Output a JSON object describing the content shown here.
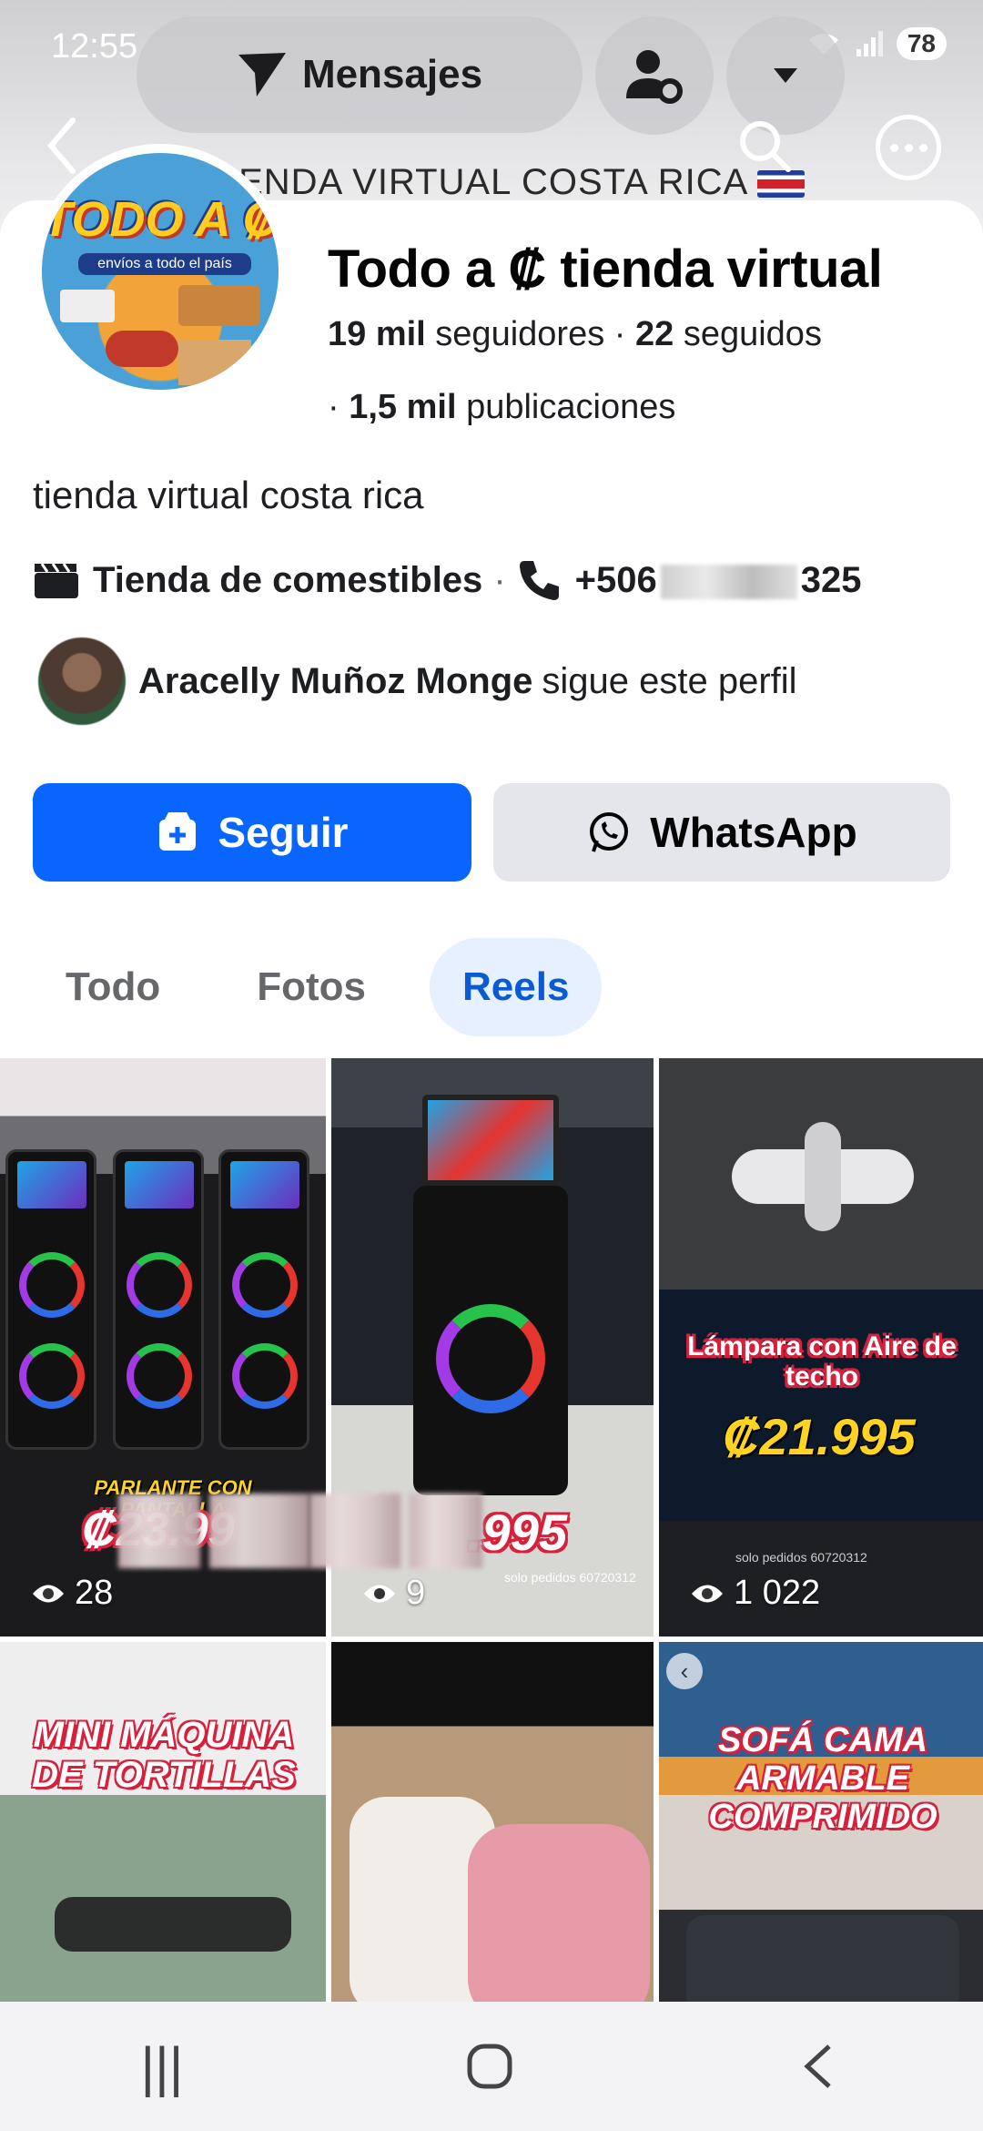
{
  "status_bar": {
    "time": "12:55",
    "battery": "78"
  },
  "header": {
    "messages_label": "Mensajes",
    "cover_text": "IENDA VIRTUAL COSTA RICA"
  },
  "profile": {
    "avatar_logo": "TODO A ₡",
    "avatar_sub": "envíos a todo el país",
    "name": "Todo a ₡ tienda virtual",
    "followers_count": "19 mil",
    "followers_label": "seguidores",
    "following_count": "22",
    "following_label": "seguidos",
    "posts_prefix": "· ",
    "posts_count": "1,5 mil",
    "posts_label": "publicaciones",
    "bio": "tienda virtual costa rica",
    "category": "Tienda de comestibles",
    "phone_start": "+506",
    "phone_end": "325",
    "mutual_follower_name": "Aracelly Muñoz Monge",
    "mutual_follower_text": "sigue este perfil"
  },
  "actions": {
    "follow_label": "Seguir",
    "whatsapp_label": "WhatsApp"
  },
  "tabs": [
    {
      "label": "Todo",
      "active": false
    },
    {
      "label": "Fotos",
      "active": false
    },
    {
      "label": "Reels",
      "active": true
    }
  ],
  "reels": [
    {
      "caption": "PARLANTE CON PANTALLA",
      "price": "₡23.99",
      "views": "28",
      "note": ""
    },
    {
      "caption": "",
      "price": ".995",
      "views": "9",
      "note": "solo pedidos 60720312"
    },
    {
      "caption": "Lámpara con Aire de techo",
      "price": "₡21.995",
      "views": "1 022",
      "note": "solo pedidos 60720312"
    },
    {
      "caption": "MINI MÁQUINA DE TORTILLAS",
      "price": "",
      "views": "",
      "note": ""
    },
    {
      "caption": "",
      "price": "",
      "views": "",
      "note": ""
    },
    {
      "caption": "SOFÁ CAMA ARMABLE COMPRIMIDO",
      "price": "",
      "views": "",
      "note": ""
    }
  ],
  "colors": {
    "primary": "#0866ff",
    "tab_active_bg": "#e7f0ff",
    "tab_active_text": "#0a5ad4",
    "secondary_btn": "#e4e6eb"
  }
}
